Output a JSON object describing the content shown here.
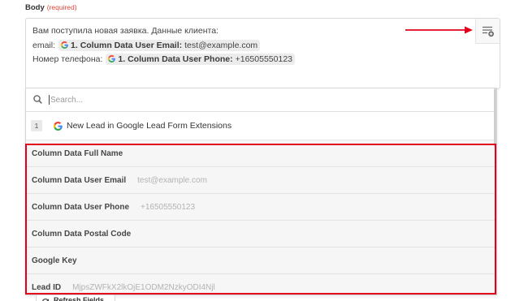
{
  "field": {
    "label": "Body",
    "required_note": "(required)"
  },
  "editor": {
    "intro_line": "Вам поступила новая заявка. Данные клиента:",
    "email_line": {
      "prefix": "email:",
      "chip": {
        "icon": "google-g-icon",
        "field": "1. Column Data User Email:",
        "value": "test@example.com"
      }
    },
    "phone_line": {
      "prefix": "Номер телефона:",
      "chip": {
        "icon": "google-g-icon",
        "field": "1. Column Data User Phone:",
        "value": "+16505550123"
      }
    },
    "insert_button_icon": "insert-field-icon"
  },
  "dropdown": {
    "search": {
      "icon": "search-icon",
      "placeholder": "Search..."
    },
    "step": {
      "number": "1",
      "app_icon": "google-g-icon",
      "title": "New Lead in Google Lead Form Extensions"
    },
    "fields": [
      {
        "label": "Column Data Full Name"
      },
      {
        "label": "Column Data User Email",
        "value": "test@example.com"
      },
      {
        "label": "Column Data User Phone",
        "value": "+16505550123"
      },
      {
        "label": "Column Data Postal Code"
      },
      {
        "label": "Google Key"
      },
      {
        "label": "Lead ID",
        "value": "MjpsZWFkX2lkOjE1ODM2NzkyODI4Njl"
      }
    ]
  },
  "refresh_button": {
    "icon": "refresh-icon",
    "label": "Refresh Fields"
  },
  "colors": {
    "required_text": "#e2473b",
    "annotation_red": "#e3001b",
    "chip_background": "#ececec",
    "list_background": "#f6f6f6",
    "value_text": "#b3b3b3"
  }
}
